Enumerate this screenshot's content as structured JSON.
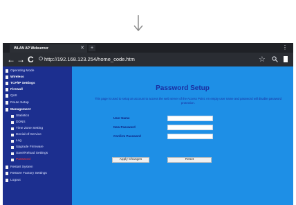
{
  "browser": {
    "tab_title": "WLAN AP Webserver",
    "tab_close": "✕",
    "new_tab": "+",
    "menu": "⋮",
    "back": "←",
    "forward": "→",
    "reload": "C",
    "url": "http://192.168.123.254/home_code.htm",
    "star": "☆"
  },
  "sidebar": {
    "items": [
      {
        "label": "Operating Mode"
      },
      {
        "label": "Wireless"
      },
      {
        "label": "TCP/IP Settings"
      },
      {
        "label": "Firewall"
      },
      {
        "label": "QoS"
      },
      {
        "label": "Route Setup"
      },
      {
        "label": "Management"
      },
      {
        "label": "Statistics"
      },
      {
        "label": "DDNS"
      },
      {
        "label": "Time Zone Setting"
      },
      {
        "label": "Denial-of-Service"
      },
      {
        "label": "Log"
      },
      {
        "label": "Upgrade Firmware"
      },
      {
        "label": "Save/Reload Settings"
      },
      {
        "label": "Password"
      },
      {
        "label": "Restart System"
      },
      {
        "label": "Restore Factory Settings"
      },
      {
        "label": "Logout"
      }
    ]
  },
  "main": {
    "title": "Password Setup",
    "description": "This page is used to setup an account to access the web server of the Access Point. An empty user name and password will disable password protection.",
    "fields": [
      {
        "label": "User Name",
        "value": ""
      },
      {
        "label": "New Password",
        "value": ""
      },
      {
        "label": "Confirm Password",
        "value": ""
      }
    ],
    "apply_button": "Apply Changes",
    "reset_button": "Reset"
  }
}
